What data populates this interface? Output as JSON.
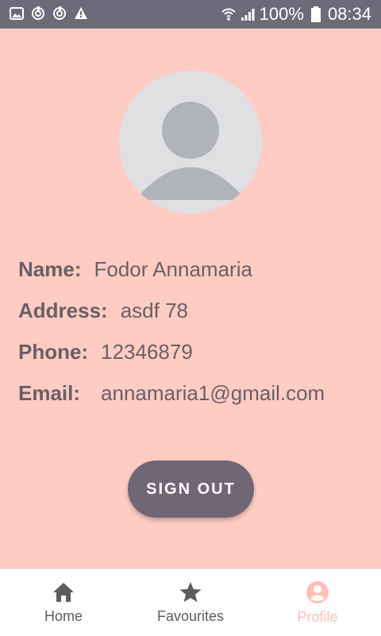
{
  "status_bar": {
    "battery": "100%",
    "time": "08:34",
    "left_icons": [
      "image-icon",
      "sync-icon",
      "sync-icon",
      "warning-icon"
    ],
    "right_icons": [
      "wifi-icon",
      "signal-icon",
      "battery-icon"
    ]
  },
  "profile": {
    "name_label": "Name:",
    "name_value": "Fodor Annamaria",
    "address_label": "Address:",
    "address_value": "asdf 78",
    "phone_label": "Phone:",
    "phone_value": "12346879",
    "email_label": "Email:",
    "email_value": "annamaria1@gmail.com"
  },
  "actions": {
    "sign_out": "SIGN OUT"
  },
  "bottom_nav": {
    "home": "Home",
    "favourites": "Favourites",
    "profile": "Profile",
    "selected": "Profile"
  },
  "colors": {
    "background": "#ffccc4",
    "status_bar": "#6f6a7a",
    "button": "#6f6676",
    "text": "#6a5f63",
    "nav_inactive": "#5f5a5e",
    "nav_active": "#ffc0b8"
  }
}
